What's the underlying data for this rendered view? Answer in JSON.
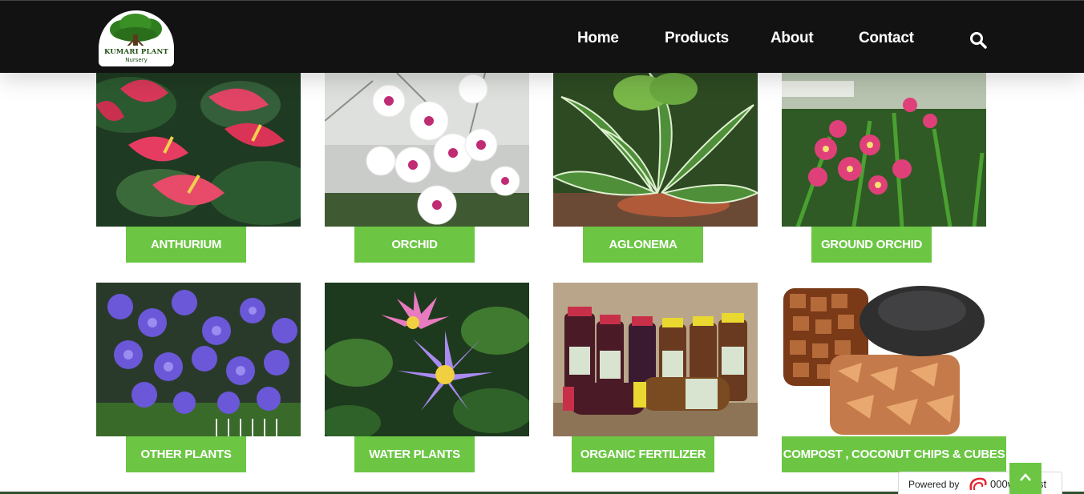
{
  "header": {
    "logo": {
      "name": "KUMARI PLANT",
      "sub": "Nursery"
    },
    "nav": [
      "Home",
      "Products",
      "About",
      "Contact"
    ],
    "search_icon": "search-icon"
  },
  "products": [
    {
      "label": "ANTHURIUM"
    },
    {
      "label": "ORCHID"
    },
    {
      "label": "AGLONEMA"
    },
    {
      "label": "GROUND ORCHID"
    },
    {
      "label": "OTHER PLANTS"
    },
    {
      "label": "WATER PLANTS"
    },
    {
      "label": "ORGANIC FERTILIZER"
    },
    {
      "label": "COMPOST , COCONUT CHIPS & CUBES"
    }
  ],
  "footer": {
    "powered_by": "Powered by",
    "brand": "000webhost",
    "back_to_top_icon": "chevron-up-icon"
  },
  "colors": {
    "header_bg": "#121212",
    "accent": "#6cc644",
    "text_light": "#ffffff"
  }
}
